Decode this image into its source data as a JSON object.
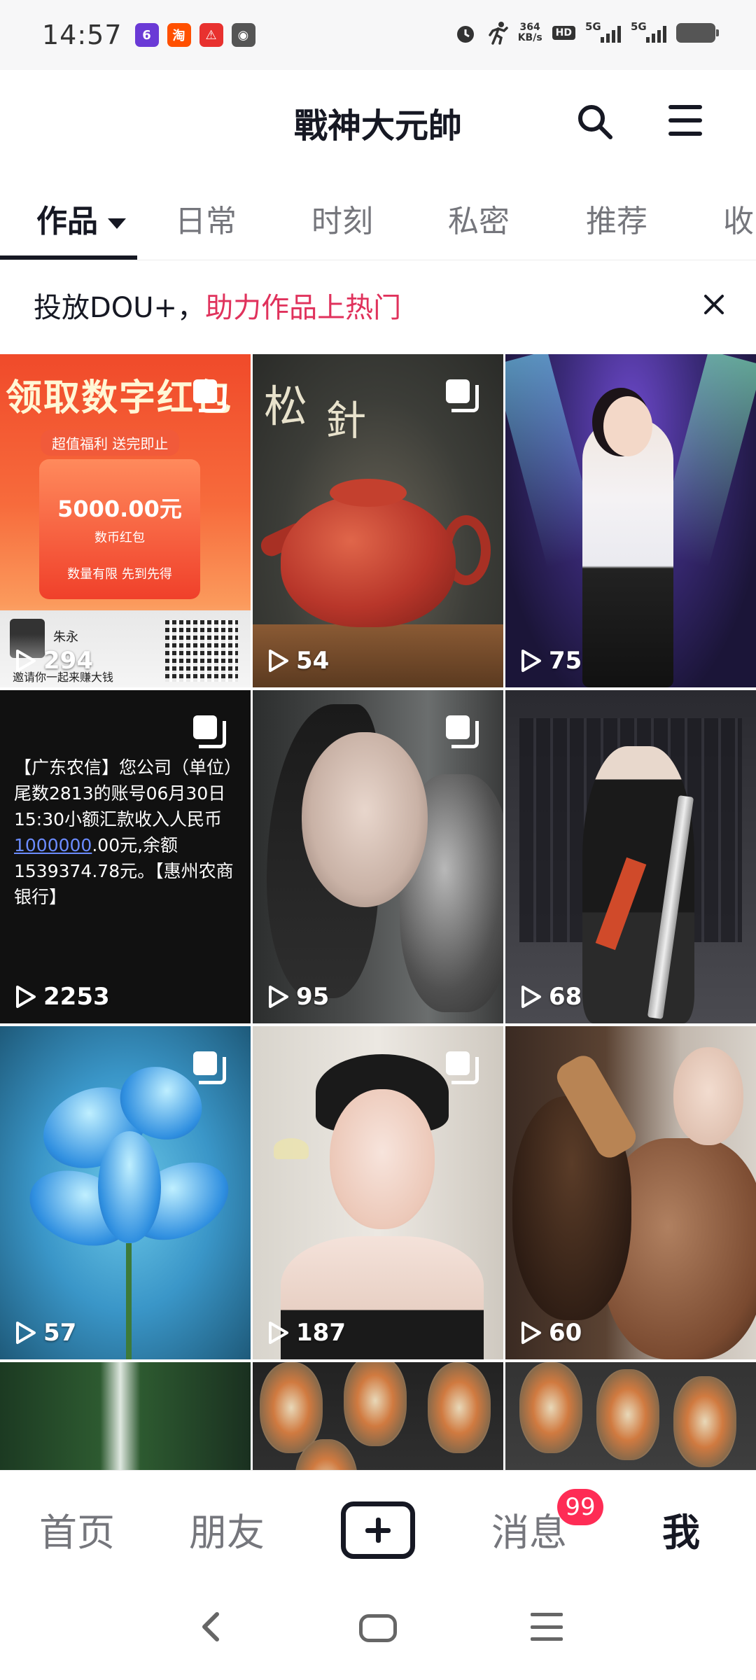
{
  "status_bar": {
    "time": "14:57",
    "app_icons": [
      {
        "name": "app-6-icon",
        "label": "6",
        "color": "#6a3ad6"
      },
      {
        "name": "taobao-icon",
        "label": "淘",
        "color": "#ff5000"
      },
      {
        "name": "app-red-icon",
        "label": "⚠",
        "color": "#e8312f"
      },
      {
        "name": "recorder-icon",
        "label": "◉",
        "color": "#555555"
      }
    ],
    "net_speed_value": "364",
    "net_speed_unit": "KB/s",
    "hd_label": "HD",
    "sim1_label": "5G",
    "sim2_label": "5G"
  },
  "header": {
    "title": "戰神大元帥"
  },
  "tabs": [
    {
      "label": "作品",
      "active": true
    },
    {
      "label": "日常",
      "active": false
    },
    {
      "label": "时刻",
      "active": false
    },
    {
      "label": "私密",
      "active": false
    },
    {
      "label": "推荐",
      "active": false
    },
    {
      "label": "收",
      "active": false
    }
  ],
  "promo": {
    "text": "投放DOU+，",
    "link": "助力作品上热门"
  },
  "grid": {
    "items": [
      {
        "count": "294",
        "multi": true
      },
      {
        "count": "54",
        "multi": true
      },
      {
        "count": "75",
        "multi": false
      },
      {
        "count": "2253",
        "multi": true
      },
      {
        "count": "95",
        "multi": true
      },
      {
        "count": "68",
        "multi": false
      },
      {
        "count": "57",
        "multi": true
      },
      {
        "count": "187",
        "multi": true
      },
      {
        "count": "60",
        "multi": false
      }
    ],
    "card1": {
      "headline": "领取数字红包",
      "sub": "超值福利  送完即止",
      "amount": "5000.00元",
      "amount_sub": "数币红包",
      "limit": "数量有限  先到先得",
      "author": "朱永",
      "invite": "邀请你一起来赚大钱"
    },
    "card2": {
      "calligraphy_1": "松",
      "calligraphy_2": "針"
    },
    "card4": {
      "sms_before": "【广东农信】您公司（单位）尾数2813的账号06月30日15:30小额汇款收入人民币",
      "sms_link": "1000000",
      "sms_after": ".00元,余额1539374.78元。【惠州农商银行】"
    }
  },
  "bottom_nav": {
    "home": "首页",
    "friends": "朋友",
    "messages": "消息",
    "messages_badge": "99",
    "me": "我"
  },
  "colors": {
    "accent": "#fe2c55",
    "promo_link": "#e0325c",
    "text_primary": "#161823",
    "text_secondary": "#75767c"
  }
}
